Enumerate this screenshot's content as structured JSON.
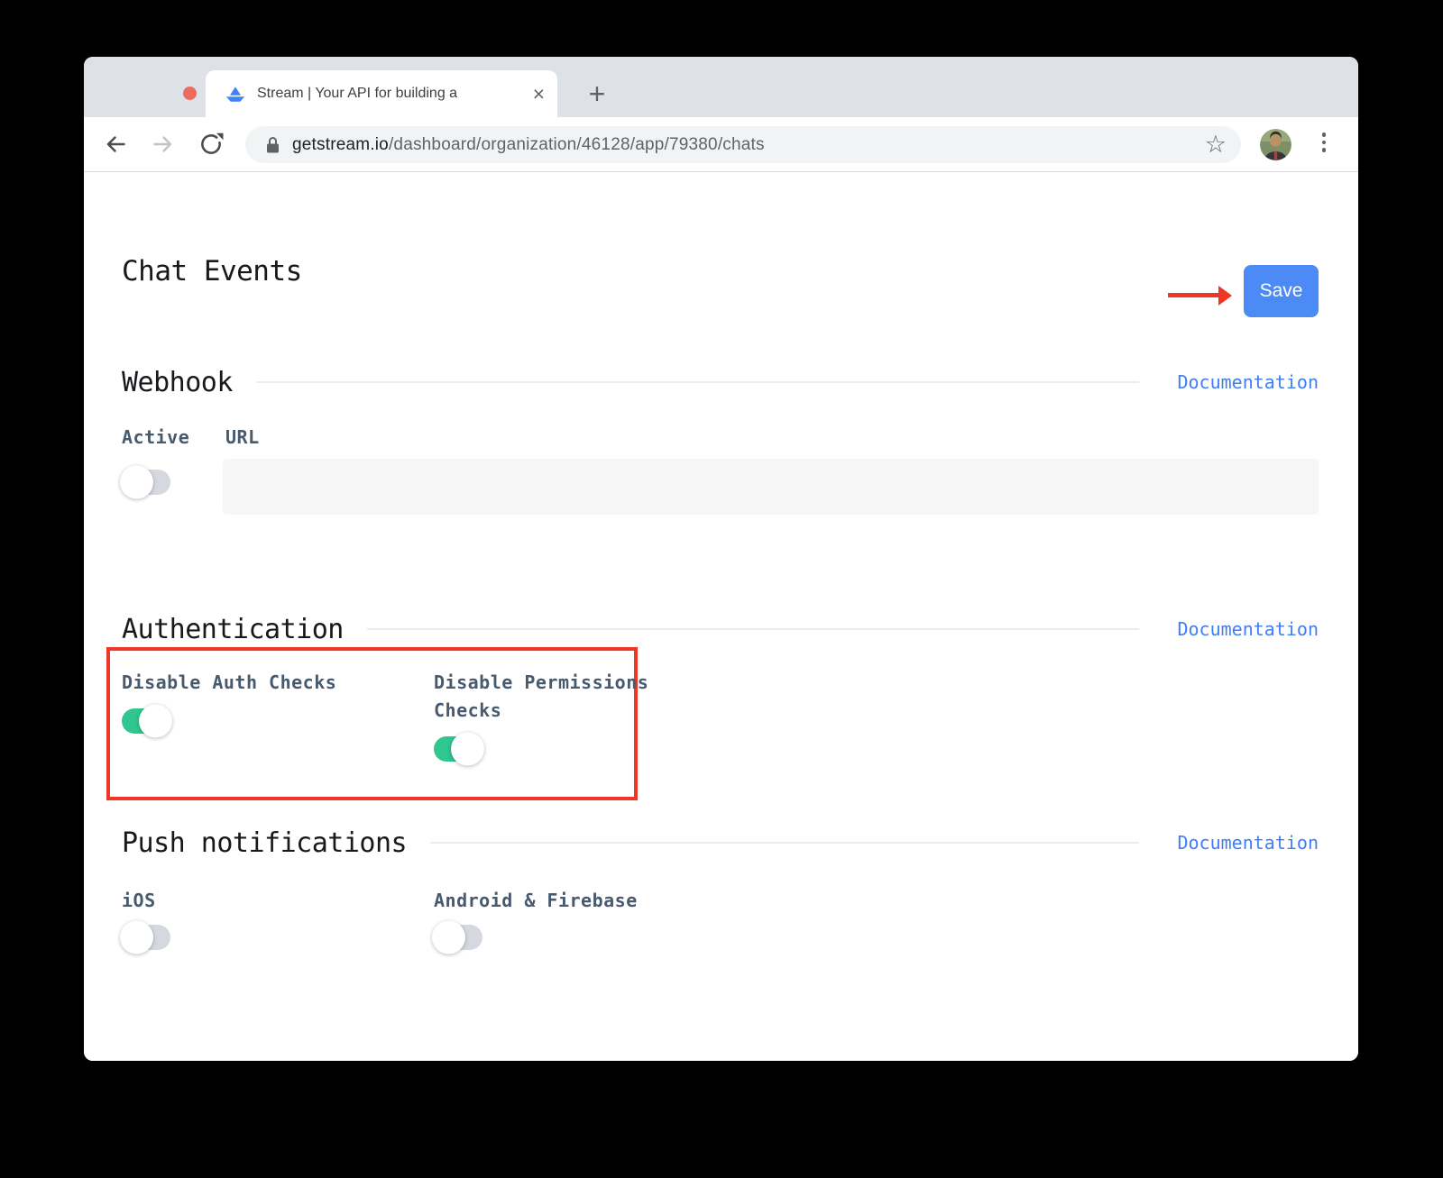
{
  "colors": {
    "save_blue": "#4c8bf5",
    "link_blue": "#3f7ef7",
    "toggle_on_green": "#2fc78f",
    "toggle_off_gray": "#d5d9df",
    "annotation_red": "#ee3724"
  },
  "browser": {
    "tab_title": "Stream | Your API for building a",
    "url_domain": "getstream.io",
    "url_path": "/dashboard/organization/46128/app/79380/chats"
  },
  "icons": {
    "star": "☆",
    "close_tab": "×",
    "new_tab": "+"
  },
  "page": {
    "title": "Chat Events",
    "save_label": "Save",
    "sections": [
      {
        "title": "Webhook",
        "doc_label": "Documentation",
        "fields": [
          {
            "label": "Active",
            "type": "toggle",
            "state": "off"
          },
          {
            "label": "URL",
            "type": "text-input",
            "value": ""
          }
        ]
      },
      {
        "title": "Authentication",
        "doc_label": "Documentation",
        "fields": [
          {
            "label": "Disable Auth Checks",
            "type": "toggle",
            "state": "on"
          },
          {
            "label": "Disable Permissions Checks",
            "type": "toggle",
            "state": "on"
          }
        ]
      },
      {
        "title": "Push notifications",
        "doc_label": "Documentation",
        "fields": [
          {
            "label": "iOS",
            "type": "toggle",
            "state": "off"
          },
          {
            "label": "Android & Firebase",
            "type": "toggle",
            "state": "off"
          }
        ]
      }
    ]
  }
}
